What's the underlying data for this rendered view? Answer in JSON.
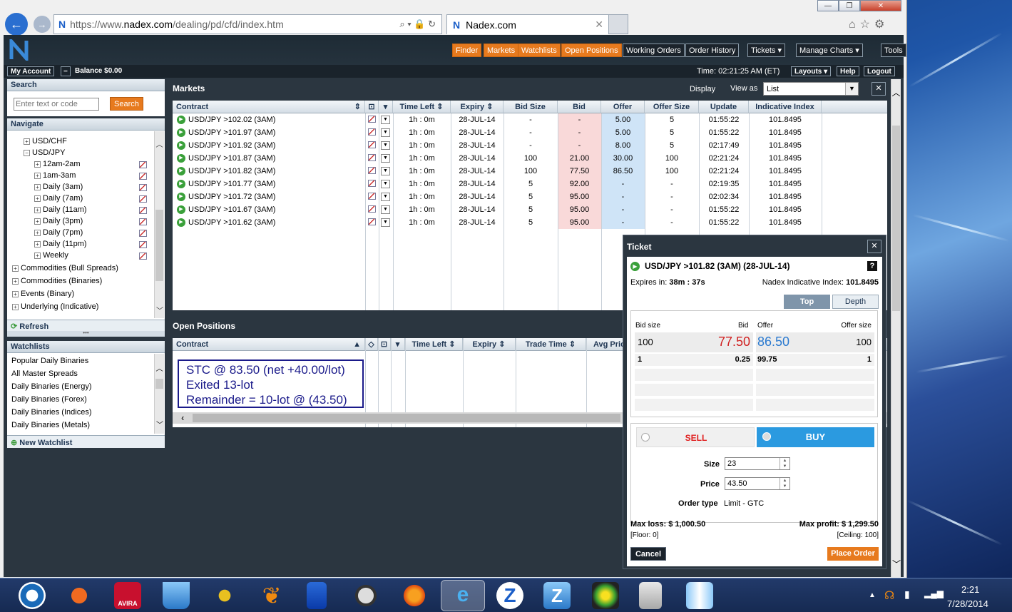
{
  "browser": {
    "url_prefix": "https://www.",
    "url_host": "nadex.com",
    "url_path": "/dealing/pd/cfd/index.htm",
    "tab_title": "Nadex.com"
  },
  "nav": {
    "orange": [
      "Finder",
      "Markets",
      "Watchlists",
      "Open Positions"
    ],
    "dark": [
      "Working Orders",
      "Order History",
      "Tickets ▾",
      "Manage Charts ▾",
      "Tools"
    ]
  },
  "account": {
    "my_account": "My Account",
    "balance": "Balance $0.00",
    "time": "Time: 02:21:25 AM (ET)",
    "layouts": "Layouts ▾",
    "help": "Help",
    "logout": "Logout"
  },
  "search": {
    "title": "Search",
    "placeholder": "Enter text or code",
    "button": "Search"
  },
  "navigate": {
    "title": "Navigate",
    "items": [
      "USD/CHF",
      "USD/JPY",
      "12am-2am",
      "1am-3am",
      "Daily (3am)",
      "Daily (7am)",
      "Daily (11am)",
      "Daily (3pm)",
      "Daily (7pm)",
      "Daily (11pm)",
      "Weekly",
      "Commodities (Bull Spreads)",
      "Commodities (Binaries)",
      "Events (Binary)",
      "Underlying (Indicative)"
    ],
    "refresh": "Refresh"
  },
  "watchlists": {
    "title": "Watchlists",
    "items": [
      "Popular Daily Binaries",
      "All Master Spreads",
      "Daily Binaries (Energy)",
      "Daily Binaries (Forex)",
      "Daily Binaries (Indices)",
      "Daily Binaries (Metals)"
    ],
    "new": "New Watchlist"
  },
  "markets": {
    "title": "Markets",
    "display": "Display",
    "view_as": "View as",
    "view_value": "List",
    "headers": [
      "Contract",
      "Time Left",
      "Expiry",
      "Bid Size",
      "Bid",
      "Offer",
      "Offer Size",
      "Update",
      "Indicative Index"
    ],
    "rows": [
      [
        "USD/JPY >102.02 (3AM)",
        "1h : 0m",
        "28-JUL-14",
        "-",
        "-",
        "5.00",
        "5",
        "01:55:22",
        "101.8495"
      ],
      [
        "USD/JPY >101.97 (3AM)",
        "1h : 0m",
        "28-JUL-14",
        "-",
        "-",
        "5.00",
        "5",
        "01:55:22",
        "101.8495"
      ],
      [
        "USD/JPY >101.92 (3AM)",
        "1h : 0m",
        "28-JUL-14",
        "-",
        "-",
        "8.00",
        "5",
        "02:17:49",
        "101.8495"
      ],
      [
        "USD/JPY >101.87 (3AM)",
        "1h : 0m",
        "28-JUL-14",
        "100",
        "21.00",
        "30.00",
        "100",
        "02:21:24",
        "101.8495"
      ],
      [
        "USD/JPY >101.82 (3AM)",
        "1h : 0m",
        "28-JUL-14",
        "100",
        "77.50",
        "86.50",
        "100",
        "02:21:24",
        "101.8495"
      ],
      [
        "USD/JPY >101.77 (3AM)",
        "1h : 0m",
        "28-JUL-14",
        "5",
        "92.00",
        "-",
        "-",
        "02:19:35",
        "101.8495"
      ],
      [
        "USD/JPY >101.72 (3AM)",
        "1h : 0m",
        "28-JUL-14",
        "5",
        "95.00",
        "-",
        "-",
        "02:02:34",
        "101.8495"
      ],
      [
        "USD/JPY >101.67 (3AM)",
        "1h : 0m",
        "28-JUL-14",
        "5",
        "95.00",
        "-",
        "-",
        "01:55:22",
        "101.8495"
      ],
      [
        "USD/JPY >101.62 (3AM)",
        "1h : 0m",
        "28-JUL-14",
        "5",
        "95.00",
        "-",
        "-",
        "01:55:22",
        "101.8495"
      ]
    ]
  },
  "positions": {
    "title": "Open Positions",
    "headers": [
      "Contract",
      "Time Left",
      "Expiry",
      "Trade Time",
      "Avg Pric"
    ],
    "note": [
      "STC @ 83.50 (net +40.00/lot)",
      "Exited 13-lot",
      "Remainder = 10-lot @ (43.50)"
    ]
  },
  "ticket": {
    "title": "Ticket",
    "contract": "USD/JPY >101.82 (3AM) (28-JUL-14)",
    "help": "?",
    "expires_label": "Expires in:",
    "expires_value": "38m : 37s",
    "index_label": "Nadex Indicative Index:",
    "index_value": "101.8495",
    "tab_top": "Top",
    "tab_depth": "Depth",
    "bid_size_h": "Bid size",
    "bid_h": "Bid",
    "offer_h": "Offer",
    "offer_size_h": "Offer size",
    "best_bid_size": "100",
    "best_bid": "77.50",
    "best_offer": "86.50",
    "best_offer_size": "100",
    "l2_bid_size": "1",
    "l2_bid": "0.25",
    "l2_offer": "99.75",
    "l2_offer_size": "1",
    "sell": "SELL",
    "buy": "BUY",
    "size_label": "Size",
    "size_value": "23",
    "price_label": "Price",
    "price_value": "43.50",
    "order_type_label": "Order type",
    "order_type_value": "Limit - GTC",
    "max_loss_label": "Max loss:",
    "max_loss_value": "$ 1,000.50",
    "floor": "[Floor: 0]",
    "max_profit_label": "Max profit:",
    "max_profit_value": "$ 1,299.50",
    "ceiling": "[Ceiling: 100]",
    "cancel": "Cancel",
    "place": "Place Order"
  },
  "clock": {
    "time": "2:21",
    "date": "7/28/2014"
  },
  "colors": {
    "orange": "#e77a1e",
    "bid_bg": "#f9d9d9",
    "offer_bg": "#cfe4f7",
    "buy": "#2b9ae0",
    "sell": "#e02020"
  }
}
